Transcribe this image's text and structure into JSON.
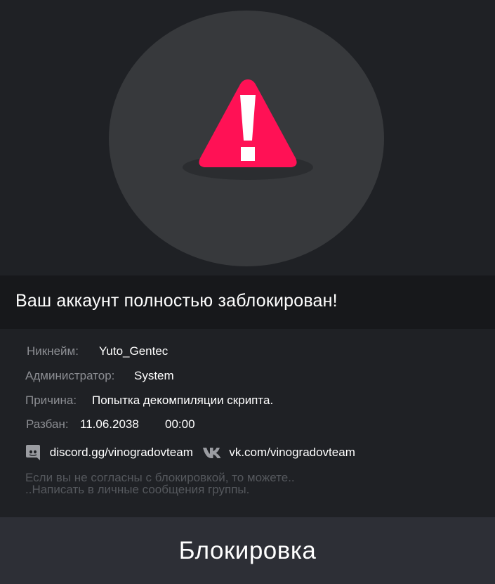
{
  "ban": {
    "title": "Ваш аккаунт полностью заблокирован!",
    "nickname_label": "Никнейм:",
    "nickname": "Yuto_Gentec",
    "admin_label": "Администратор:",
    "admin": "System",
    "reason_label": "Причина:",
    "reason": "Попытка декомпиляции скрипта.",
    "unban_label": "Разбан:",
    "unban_date": "11.06.2038",
    "unban_time": "00:00"
  },
  "links": {
    "discord": "discord.gg/vinogradovteam",
    "vk": "vk.com/vinogradovteam"
  },
  "appeal": {
    "line1": "Если вы не согласны с блокировкой, то можете..",
    "line2": "..Написать в личные сообщения группы."
  },
  "footer": {
    "button_label": "Блокировка"
  },
  "icons": {
    "warning": "warning-triangle-icon",
    "discord": "discord-icon",
    "vk": "vk-icon"
  },
  "colors": {
    "background": "#1f2125",
    "circle": "#37393c",
    "accent": "#ff1155",
    "title_bar": "#17181b",
    "footer": "#2d2f36",
    "label": "#8c8e93",
    "muted_text": "#55585d"
  }
}
